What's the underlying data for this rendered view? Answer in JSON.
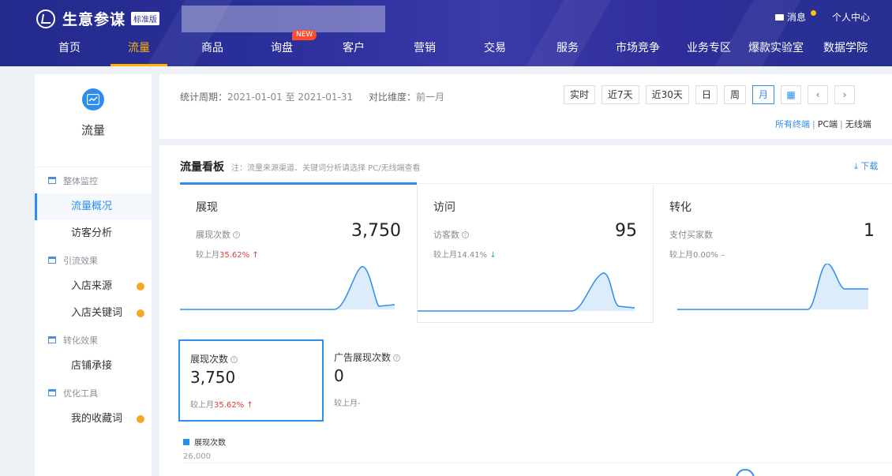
{
  "header": {
    "app_title": "生意参谋",
    "edition": "标准版",
    "messages_label": "消息",
    "personal_center_label": "个人中心",
    "nav": [
      {
        "label": "首页"
      },
      {
        "label": "流量",
        "active": true
      },
      {
        "label": "商品"
      },
      {
        "label": "询盘",
        "tag": "NEW"
      },
      {
        "label": "客户"
      },
      {
        "label": "营销"
      },
      {
        "label": "交易"
      },
      {
        "label": "服务"
      },
      {
        "label": "市场竞争"
      },
      {
        "label": "业务专区"
      },
      {
        "label": "爆款实验室"
      },
      {
        "label": "数据学院"
      }
    ],
    "colors": {
      "brand": "#2b2f9a",
      "active": "#ffb400",
      "new_tag": "#ff4d2e"
    }
  },
  "sidebar": {
    "title": "流量",
    "icon": "trend-chart-icon",
    "groups": [
      {
        "label": "整体监控",
        "items": [
          {
            "label": "流量概况",
            "active": true
          },
          {
            "label": "访客分析"
          }
        ]
      },
      {
        "label": "引流效果",
        "items": [
          {
            "label": "入店来源",
            "dot": true
          },
          {
            "label": "入店关键词",
            "dot": true
          }
        ]
      },
      {
        "label": "转化效果",
        "items": [
          {
            "label": "店铺承接"
          }
        ]
      },
      {
        "label": "优化工具",
        "items": [
          {
            "label": "我的收藏词",
            "dot": true
          }
        ]
      }
    ]
  },
  "filter": {
    "period_label": "统计周期：",
    "period_value": "2021-01-01 至 2021-01-31",
    "compare_label": "对比维度：",
    "compare_value": "前一月",
    "range_buttons": [
      "实时",
      "近7天",
      "近30天",
      "日",
      "周",
      "月"
    ],
    "active_range": "月",
    "terminals": [
      "所有终端",
      "PC端",
      "无线端"
    ],
    "active_terminal": "所有终端"
  },
  "board": {
    "title": "流量看板",
    "note": "注：流量来源渠道、关键词分析请选择 PC/无线端查看",
    "download_label": "下载",
    "kpis": [
      {
        "title": "展现",
        "label": "展现次数",
        "value": "3,750",
        "compare_prefix": "较上月",
        "compare_value": "35.62%",
        "trend": "up",
        "help": true
      },
      {
        "title": "访问",
        "label": "访客数",
        "value": "95",
        "compare_prefix": "较上月",
        "compare_value": "14.41%",
        "trend": "down",
        "help": true
      },
      {
        "title": "转化",
        "label": "支付买家数",
        "value": "1",
        "compare_prefix": "较上月",
        "compare_value": "0.00%",
        "trend": "flat",
        "help": false
      }
    ],
    "metric_cards": [
      {
        "label": "展现次数",
        "value": "3,750",
        "compare_prefix": "较上月",
        "compare_value": "35.62%",
        "selected": true
      },
      {
        "label": "广告展现次数",
        "value": "0",
        "compare_prefix": "较上月",
        "compare_value": "-",
        "selected": false
      }
    ],
    "legend_label": "展现次数",
    "axis_top": "26,000",
    "colors": {
      "accent": "#2e8ef0",
      "up": "#e4393c",
      "down": "#2cb67d"
    }
  }
}
